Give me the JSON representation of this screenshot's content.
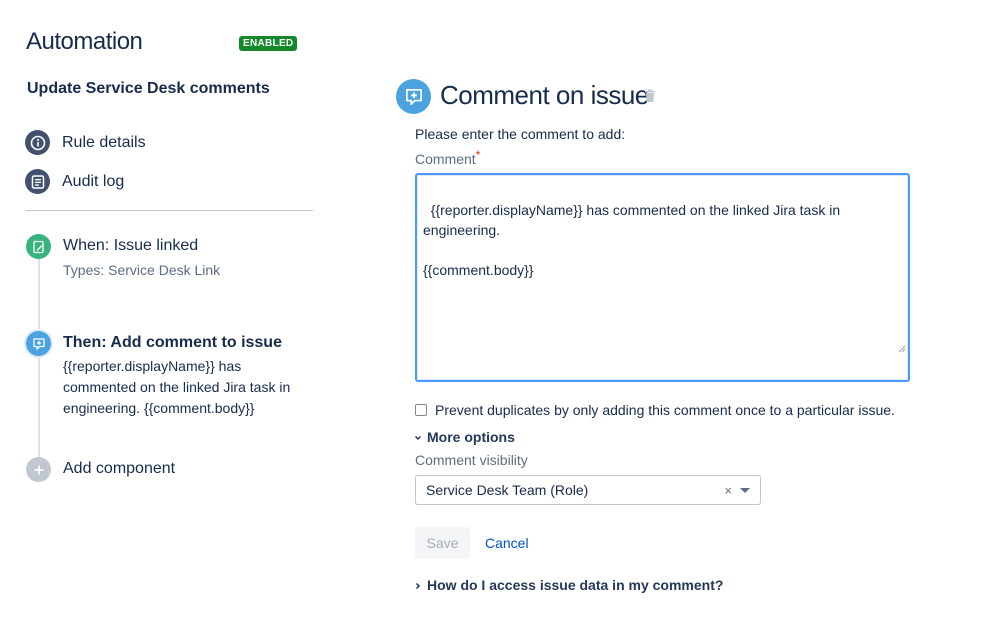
{
  "app": {
    "title": "Automation",
    "status_badge": "ENABLED",
    "rule_name": "Update Service Desk comments"
  },
  "sidebar": {
    "nav": [
      {
        "label": "Rule details",
        "icon": "info-icon"
      },
      {
        "label": "Audit log",
        "icon": "list-icon"
      }
    ],
    "steps": [
      {
        "title": "When: Issue linked",
        "subtitle": "Types: Service Desk Link",
        "icon": "edit-icon",
        "color": "#36b37e"
      },
      {
        "title": "Then: Add comment to issue",
        "description": "{{reporter.displayName}} has commented on the linked Jira task in engineering. {{comment.body}}",
        "icon": "comment-icon",
        "color": "#4aa3df"
      },
      {
        "title": "Add component",
        "icon": "plus-icon",
        "color": "#c1c7d0"
      }
    ]
  },
  "component": {
    "title": "Comment on issue",
    "prompt": "Please enter the comment to add:",
    "comment_label": "Comment",
    "required_marker": "*",
    "comment_value": "{{reporter.displayName}} has commented on the linked Jira task in engineering.\n\n{{comment.body}}",
    "prevent_duplicates_label": "Prevent duplicates by only adding this comment once to a particular issue.",
    "prevent_duplicates_checked": false,
    "more_options_label": "More options",
    "visibility_label": "Comment visibility",
    "visibility_value": "Service Desk Team (Role)",
    "clear_glyph": "×",
    "save_label": "Save",
    "cancel_label": "Cancel",
    "help_label": "How do I access issue data in my comment?"
  },
  "colors": {
    "accent": "#4c9aff",
    "link": "#0052cc",
    "enabled": "#14892c",
    "text": "#172b4d"
  }
}
